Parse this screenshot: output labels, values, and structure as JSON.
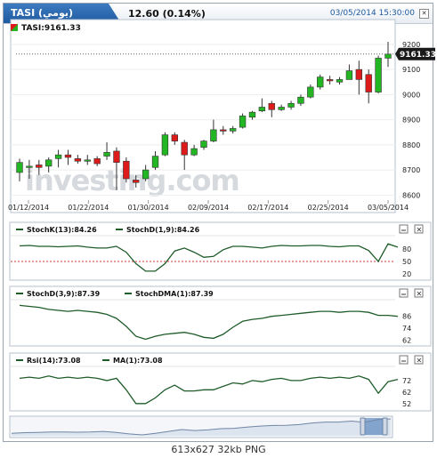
{
  "header": {
    "symbol": "TASI (يومي)",
    "price": "12.60 (0.14%)",
    "datetime": "03/05/2014 15:30:00"
  },
  "watermark": "investing.com",
  "footer": "613x627  32kb  PNG",
  "colors": {
    "up": "#22b622",
    "down": "#dd1b1b",
    "osc_line": "#1f5c2a",
    "ref_line": "#d43a3a"
  },
  "chart_data": [
    {
      "type": "candlestick",
      "legend": "TASI:9161.33",
      "last_value": "9161.33",
      "x_tick_labels": [
        "01/12/2014",
        "01/22/2014",
        "01/30/2014",
        "02/09/2014",
        "02/17/2014",
        "02/25/2014",
        "03/05/2014"
      ],
      "y_ticks": [
        9200,
        9100,
        9000,
        8900,
        8800,
        8700,
        8600
      ],
      "ylim": [
        8580,
        9235
      ],
      "candles": [
        {
          "o": 8690,
          "c": 8730,
          "h": 8745,
          "l": 8655
        },
        {
          "o": 8710,
          "c": 8715,
          "h": 8740,
          "l": 8665
        },
        {
          "o": 8720,
          "c": 8710,
          "h": 8740,
          "l": 8680
        },
        {
          "o": 8715,
          "c": 8740,
          "h": 8750,
          "l": 8690
        },
        {
          "o": 8745,
          "c": 8760,
          "h": 8780,
          "l": 8710
        },
        {
          "o": 8760,
          "c": 8750,
          "h": 8780,
          "l": 8720
        },
        {
          "o": 8745,
          "c": 8735,
          "h": 8760,
          "l": 8725
        },
        {
          "o": 8735,
          "c": 8740,
          "h": 8760,
          "l": 8720
        },
        {
          "o": 8745,
          "c": 8725,
          "h": 8755,
          "l": 8715
        },
        {
          "o": 8755,
          "c": 8770,
          "h": 8810,
          "l": 8740
        },
        {
          "o": 8775,
          "c": 8730,
          "h": 8790,
          "l": 8620
        },
        {
          "o": 8735,
          "c": 8665,
          "h": 8750,
          "l": 8650
        },
        {
          "o": 8660,
          "c": 8650,
          "h": 8680,
          "l": 8630
        },
        {
          "o": 8665,
          "c": 8700,
          "h": 8720,
          "l": 8655
        },
        {
          "o": 8710,
          "c": 8755,
          "h": 8775,
          "l": 8700
        },
        {
          "o": 8760,
          "c": 8840,
          "h": 8850,
          "l": 8755
        },
        {
          "o": 8840,
          "c": 8815,
          "h": 8850,
          "l": 8800
        },
        {
          "o": 8810,
          "c": 8760,
          "h": 8820,
          "l": 8700
        },
        {
          "o": 8760,
          "c": 8785,
          "h": 8800,
          "l": 8755
        },
        {
          "o": 8790,
          "c": 8815,
          "h": 8820,
          "l": 8780
        },
        {
          "o": 8815,
          "c": 8860,
          "h": 8900,
          "l": 8810
        },
        {
          "o": 8860,
          "c": 8855,
          "h": 8875,
          "l": 8840
        },
        {
          "o": 8855,
          "c": 8865,
          "h": 8875,
          "l": 8845
        },
        {
          "o": 8870,
          "c": 8915,
          "h": 8925,
          "l": 8865
        },
        {
          "o": 8910,
          "c": 8930,
          "h": 8935,
          "l": 8900
        },
        {
          "o": 8935,
          "c": 8950,
          "h": 8985,
          "l": 8930
        },
        {
          "o": 8965,
          "c": 8940,
          "h": 8975,
          "l": 8910
        },
        {
          "o": 8940,
          "c": 8950,
          "h": 8960,
          "l": 8935
        },
        {
          "o": 8950,
          "c": 8965,
          "h": 8975,
          "l": 8940
        },
        {
          "o": 8965,
          "c": 8990,
          "h": 9000,
          "l": 8955
        },
        {
          "o": 8990,
          "c": 9030,
          "h": 9040,
          "l": 8985
        },
        {
          "o": 9030,
          "c": 9070,
          "h": 9080,
          "l": 9020
        },
        {
          "o": 9060,
          "c": 9055,
          "h": 9075,
          "l": 9040
        },
        {
          "o": 9050,
          "c": 9060,
          "h": 9070,
          "l": 9040
        },
        {
          "o": 9060,
          "c": 9095,
          "h": 9120,
          "l": 9060
        },
        {
          "o": 9100,
          "c": 9060,
          "h": 9135,
          "l": 9000
        },
        {
          "o": 9080,
          "c": 9010,
          "h": 9100,
          "l": 8965
        },
        {
          "o": 9010,
          "c": 9145,
          "h": 9155,
          "l": 9005
        },
        {
          "o": 9145,
          "c": 9161,
          "h": 9210,
          "l": 9110
        }
      ]
    },
    {
      "type": "line",
      "series": [
        {
          "name": "StochK(13):84.26",
          "values": [
            87,
            88,
            86,
            86,
            85,
            86,
            87,
            84,
            82,
            82,
            86,
            72,
            45,
            27,
            27,
            45,
            75,
            82,
            72,
            60,
            62,
            78,
            86,
            86,
            84,
            82,
            86,
            88,
            87,
            87,
            88,
            88,
            86,
            85,
            87,
            87,
            76,
            50,
            92,
            84
          ]
        },
        {
          "name": "StochD(1,9):84.26",
          "values": []
        }
      ],
      "y_ticks": [
        80,
        50,
        20
      ],
      "ylim": [
        12,
        105
      ],
      "ref_line": 50
    },
    {
      "type": "line",
      "series": [
        {
          "name": "StochD(3,9):87.39",
          "values": [
            97,
            96,
            95,
            93,
            92,
            91,
            92,
            91,
            90,
            88,
            84,
            76,
            66,
            63,
            66,
            68,
            69,
            70,
            68,
            65,
            64,
            68,
            75,
            81,
            83,
            84,
            86,
            87,
            88,
            89,
            90,
            91,
            91,
            90,
            91,
            91,
            90,
            87,
            87,
            86
          ]
        },
        {
          "name": "StochDMA(1):87.39",
          "values": []
        }
      ],
      "y_ticks": [
        86,
        74,
        62
      ],
      "ylim": [
        59,
        100
      ]
    },
    {
      "type": "line",
      "series": [
        {
          "name": "Rsi(14):73.08",
          "values": [
            74,
            75,
            74,
            76,
            74,
            75,
            74,
            75,
            74,
            72,
            74,
            64,
            52,
            52,
            57,
            64,
            68,
            63,
            63,
            64,
            64,
            67,
            70,
            69,
            72,
            71,
            73,
            74,
            72,
            72,
            74,
            75,
            74,
            75,
            74,
            76,
            73,
            61,
            71,
            73
          ]
        },
        {
          "name": "MA(1):73.08",
          "values": []
        }
      ],
      "y_ticks": [
        72,
        62,
        52
      ],
      "ylim": [
        48,
        82
      ]
    }
  ],
  "navigator": {
    "values": [
      8700,
      8720,
      8730,
      8740,
      8745,
      8735,
      8740,
      8760,
      8730,
      8680,
      8650,
      8700,
      8760,
      8820,
      8790,
      8810,
      8850,
      8860,
      8900,
      8930,
      8950,
      8955,
      8980,
      9030,
      9060,
      9060,
      9090,
      9050,
      9140,
      9161
    ]
  }
}
